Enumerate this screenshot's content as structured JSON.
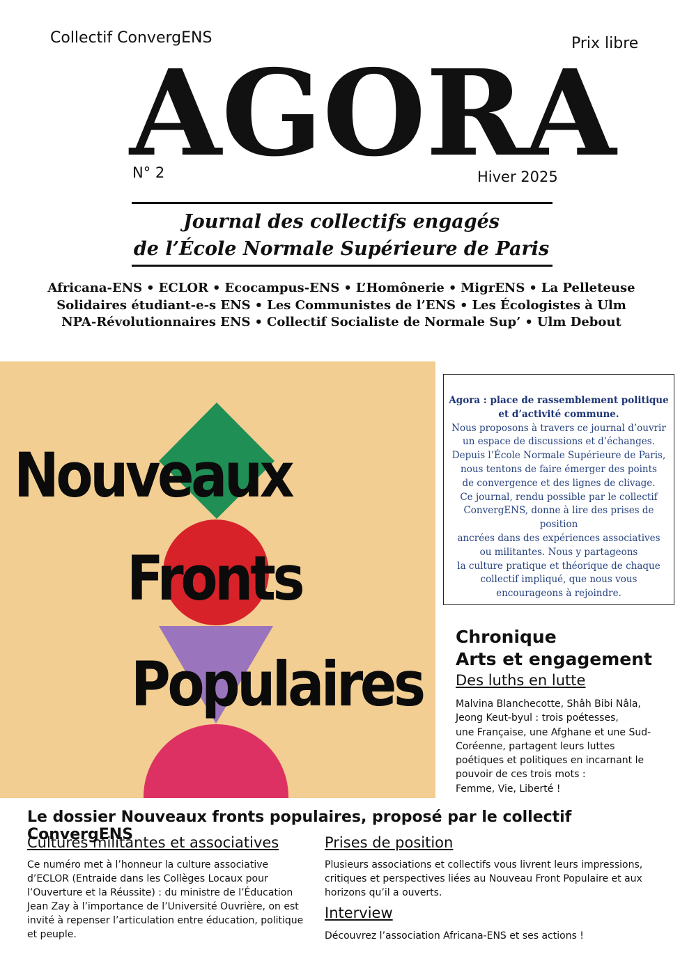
{
  "header": {
    "collective": "Collectif ConvergENS",
    "price": "Prix libre",
    "title": "AGORA",
    "issue": "N° 2",
    "season": "Hiver 2025",
    "subtitle_line1": "Journal des collectifs engagés",
    "subtitle_line2": "de l’École Normale Supérieure de Paris"
  },
  "collectives": {
    "separator": "•",
    "line1": [
      "Africana-ENS",
      "ECLOR",
      "Ecocampus-ENS",
      "L’Homônerie",
      "MigrENS",
      "La Pelleteuse"
    ],
    "line2": [
      "Solidaires étudiant-e-s ENS",
      "Les Communistes de l’ENS",
      "Les Écologistes à Ulm"
    ],
    "line3": [
      "NPA-Révolutionnaires ENS",
      "Collectif Socialiste de Normale Sup’",
      "Ulm Debout"
    ]
  },
  "cover": {
    "word1": "Nouveaux",
    "word2": "Fronts",
    "word3": "Populaires",
    "colors": {
      "background": "#f2ce92",
      "diamond": "#1f8f55",
      "circle": "#d62228",
      "triangle": "#9a74bc",
      "half_circle": "#dd3163"
    }
  },
  "agora_box": {
    "lead_line1": "Agora : place de rassemblement politique",
    "lead_line2": "et d’activité commune.",
    "lines": [
      "Nous proposons à travers ce journal d’ouvrir",
      "un espace de discussions et d’échanges.",
      "Depuis l’École Normale Supérieure de Paris,",
      "nous tentons de faire émerger des points",
      "de convergence et des lignes de clivage.",
      "Ce journal, rendu possible par le collectif",
      "ConvergENS, donne à lire des prises de position",
      "ancrées dans des expériences associatives",
      "ou militantes. Nous y partageons",
      "la culture pratique et théorique de chaque",
      "collectif impliqué, que nous vous",
      "encourageons à rejoindre."
    ],
    "text_color": "#26427e"
  },
  "chronique": {
    "kicker_line1": "Chronique",
    "kicker_line2": "Arts et engagement",
    "title": "Des luths en lutte",
    "lines": [
      "Malvina Blanchecotte, Shâh Bibi Nâla,",
      "Jeong Keut-byul : trois poétesses,",
      "une Française, une Afghane et une Sud-",
      "Coréenne, partagent leurs luttes",
      "poétiques et politiques en incarnant le",
      "pouvoir de ces trois mots :",
      "Femme, Vie, Liberté !"
    ]
  },
  "dossier": {
    "heading": "Le dossier Nouveaux fronts populaires, proposé par le collectif ConvergENS",
    "cultures": {
      "title": "Cultures militantes et associatives",
      "lines": [
        "Ce numéro met à l’honneur la culture associative",
        "d’ECLOR (Entraide dans les Collèges Locaux pour",
        "l’Ouverture et la Réussite) : du ministre de l’Éducation",
        "Jean Zay à l’importance de l’Université Ouvrière, on est",
        "invité à repenser l’articulation entre éducation, politique",
        "et peuple."
      ]
    },
    "positions": {
      "title": "Prises de position",
      "lines": [
        "Plusieurs associations et collectifs vous livrent leurs impressions,",
        "critiques et perspectives liées au Nouveau Front Populaire et aux",
        "horizons qu’il a ouverts."
      ]
    },
    "interview": {
      "title": "Interview",
      "text": "Découvrez l’association Africana-ENS et ses actions !"
    }
  }
}
